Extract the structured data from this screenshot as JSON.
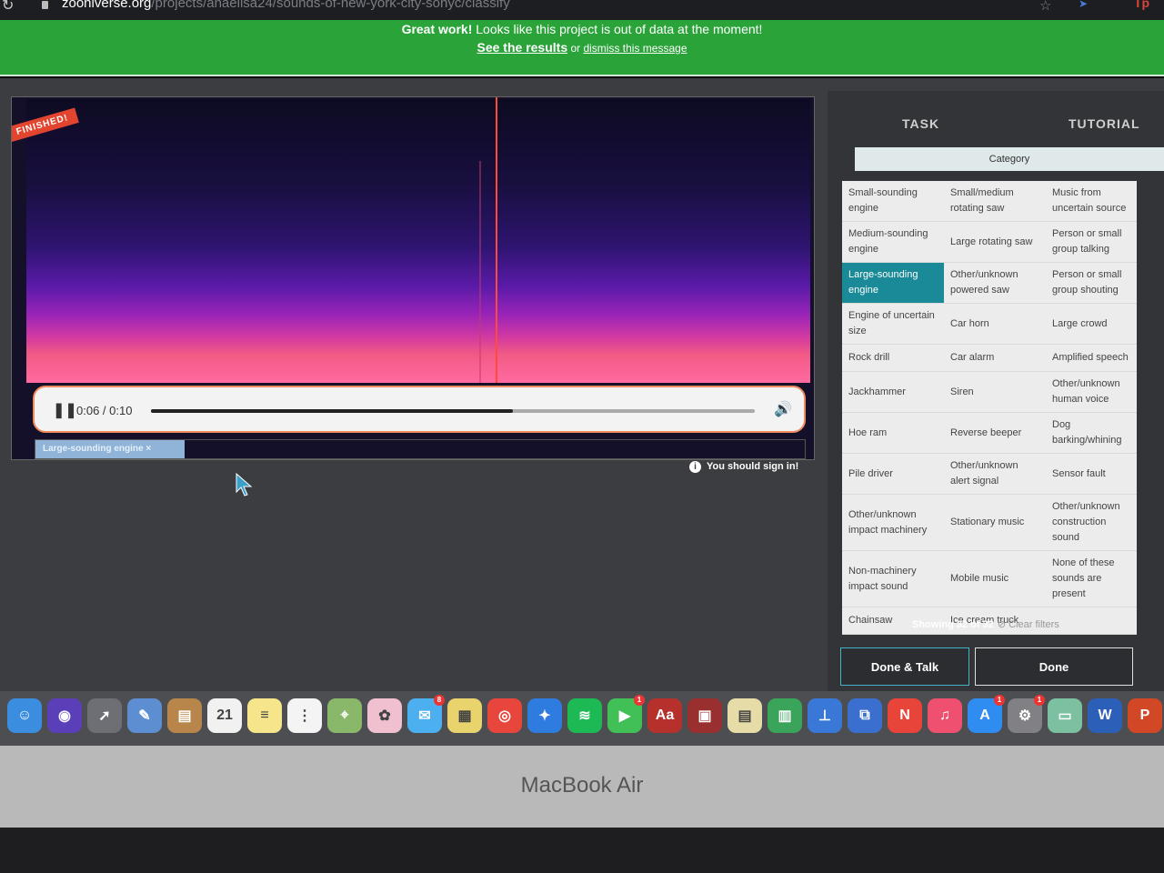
{
  "browser": {
    "url_domain": "zooniverse.org",
    "url_path": "/projects/anaelisa24/sounds-of-new-york-city-sonyc/classify"
  },
  "banner": {
    "strong": "Great work!",
    "message": " Looks like this project is out of data at the moment!",
    "results_link": "See the results",
    "or_text": " or ",
    "dismiss_link": "dismiss this message"
  },
  "subject": {
    "status_ribbon": "FINISHED!",
    "player": {
      "pause_icon": "❚❚",
      "time": "0:06 / 0:10",
      "progress": 0.6
    },
    "annotation_label": "Large-sounding engine ×"
  },
  "signin": {
    "message": "You should sign in!"
  },
  "task_panel": {
    "tabs": [
      "TASK",
      "TUTORIAL"
    ],
    "category_header": "Category",
    "options": [
      "Small-sounding engine",
      "Small/medium rotating saw",
      "Music from uncertain source",
      "Medium-sounding engine",
      "Large rotating saw",
      "Person or small group talking",
      "Large-sounding engine",
      "Other/unknown powered saw",
      "Person or small group shouting",
      "Engine of uncertain size",
      "Car horn",
      "Large crowd",
      "Rock drill",
      "Car alarm",
      "Amplified speech",
      "Jackhammer",
      "Siren",
      "Other/unknown human voice",
      "Hoe ram",
      "Reverse beeper",
      "Dog barking/whining",
      "Pile driver",
      "Other/unknown alert signal",
      "Sensor fault",
      "Other/unknown impact machinery",
      "Stationary music",
      "Other/unknown construction sound",
      "Non-machinery impact sound",
      "Mobile music",
      "None of these sounds are present",
      "Chainsaw",
      "Ice cream truck",
      ""
    ],
    "selected_option": "Large-sounding engine",
    "showing": "Showing 32 of 32",
    "clear_filters": "⊘ Clear filters",
    "done_talk_label": "Done & Talk",
    "done_label": "Done"
  },
  "dock": {
    "date_icon_day": "21",
    "items": [
      {
        "name": "finder-icon",
        "color": "#3b8de0",
        "glyph": "☺"
      },
      {
        "name": "siri-icon",
        "color": "#5b3fb8",
        "glyph": "◉"
      },
      {
        "name": "launchpad-icon",
        "color": "#6d6f75",
        "glyph": "➚"
      },
      {
        "name": "preview-icon",
        "color": "#5d8ed1",
        "glyph": "✎"
      },
      {
        "name": "contacts-icon",
        "color": "#b8854a",
        "glyph": "▤"
      },
      {
        "name": "calendar-icon",
        "color": "#f1f1f1",
        "glyph": "21"
      },
      {
        "name": "notes-icon",
        "color": "#f6e58a",
        "glyph": "≡"
      },
      {
        "name": "reminders-icon",
        "color": "#f4f4f4",
        "glyph": "⋮"
      },
      {
        "name": "maps-icon",
        "color": "#8ab86a",
        "glyph": "⌖"
      },
      {
        "name": "photos-icon",
        "color": "#f0c0d0",
        "glyph": "✿"
      },
      {
        "name": "messages-icon",
        "color": "#4cb0f0",
        "glyph": "✉",
        "badge": "8"
      },
      {
        "name": "stickies-icon",
        "color": "#e9d36c",
        "glyph": "▦"
      },
      {
        "name": "chrome-icon",
        "color": "#e8453c",
        "glyph": "◎"
      },
      {
        "name": "safari-icon",
        "color": "#2f7ce0",
        "glyph": "✦"
      },
      {
        "name": "spotify-icon",
        "color": "#1db954",
        "glyph": "≋"
      },
      {
        "name": "facetime-icon",
        "color": "#40c057",
        "glyph": "▶",
        "badge": "1"
      },
      {
        "name": "dictionary-icon",
        "color": "#b7312c",
        "glyph": "Aa"
      },
      {
        "name": "photo-booth-icon",
        "color": "#9a2f2f",
        "glyph": "▣"
      },
      {
        "name": "keynote-board-icon",
        "color": "#e6dca8",
        "glyph": "▤"
      },
      {
        "name": "numbers-icon",
        "color": "#3aa55a",
        "glyph": "▥"
      },
      {
        "name": "keynote-icon",
        "color": "#3a78d8",
        "glyph": "⊥"
      },
      {
        "name": "screen-icon",
        "color": "#3a6fd0",
        "glyph": "⧉"
      },
      {
        "name": "news-icon",
        "color": "#e8443a",
        "glyph": "N"
      },
      {
        "name": "music-icon",
        "color": "#f05070",
        "glyph": "♫"
      },
      {
        "name": "app-store-icon",
        "color": "#2f8cf0",
        "glyph": "A",
        "badge": "1"
      },
      {
        "name": "system-preferences-icon",
        "color": "#808085",
        "glyph": "⚙",
        "badge": "1"
      },
      {
        "name": "map-document-icon",
        "color": "#7bc0a0",
        "glyph": "▭"
      },
      {
        "name": "word-icon",
        "color": "#2b5fb8",
        "glyph": "W"
      },
      {
        "name": "powerpoint-icon",
        "color": "#d24726",
        "glyph": "P"
      },
      {
        "name": "downloads-icon",
        "color": "#c9c9c9",
        "glyph": "▭"
      }
    ]
  },
  "device_label": "MacBook Air"
}
